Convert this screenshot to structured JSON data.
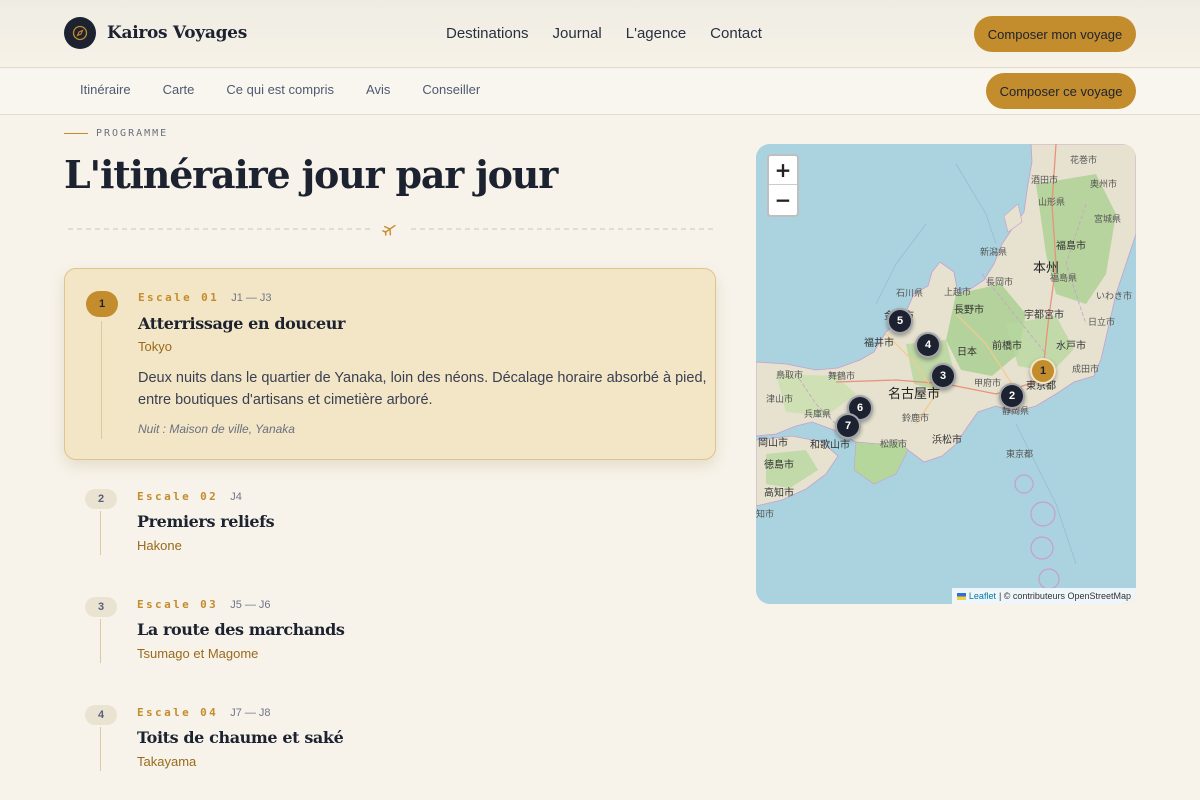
{
  "header": {
    "brand": "Kairos Voyages",
    "nav": [
      "Destinations",
      "Journal",
      "L'agence",
      "Contact"
    ],
    "cta": "Composer mon voyage"
  },
  "subnav": {
    "items": [
      "Itinéraire",
      "Carte",
      "Ce qui est compris",
      "Avis",
      "Conseiller"
    ],
    "cta": "Composer ce voyage"
  },
  "section": {
    "eyebrow": "PROGRAMME",
    "title": "L'itinéraire jour par jour"
  },
  "stops": [
    {
      "num": "1",
      "escale": "Escale 01",
      "days": "J1 — J3",
      "title": "Atterrissage en douceur",
      "place": "Tokyo",
      "description": "Deux nuits dans le quartier de Yanaka, loin des néons. Décalage horaire absorbé à pied, entre boutiques d'artisans et cimetière arboré.",
      "nuit": "Nuit : Maison de ville, Yanaka"
    },
    {
      "num": "2",
      "escale": "Escale 02",
      "days": "J4",
      "title": "Premiers reliefs",
      "place": "Hakone"
    },
    {
      "num": "3",
      "escale": "Escale 03",
      "days": "J5 — J6",
      "title": "La route des marchands",
      "place": "Tsumago et Magome"
    },
    {
      "num": "4",
      "escale": "Escale 04",
      "days": "J7 — J8",
      "title": "Toits de chaume et saké",
      "place": "Takayama"
    }
  ],
  "map": {
    "zoom_in": "+",
    "zoom_out": "−",
    "attribution_leaflet": "Leaflet",
    "attribution_rest": "| © contributeurs OpenStreetMap",
    "labels": [
      "花巻市",
      "奥州市",
      "酒田市",
      "山形県",
      "宮城県",
      "福島市",
      "本州",
      "福島県",
      "新潟県",
      "いわき市",
      "石川県",
      "上越市",
      "長岡市",
      "宇都宮市",
      "日立市",
      "金沢市",
      "長野市",
      "福井市",
      "日本",
      "前橋市",
      "水戸市",
      "鳥取市",
      "舞鶴市",
      "甲府市",
      "東京都",
      "成田市",
      "津山市",
      "名古屋市",
      "兵庫県",
      "静岡県",
      "鈴鹿市",
      "岡山市",
      "和歌山市",
      "松阪市",
      "浜松市",
      "徳島市",
      "東京都",
      "高知市",
      "知市"
    ],
    "markers": [
      "1",
      "2",
      "3",
      "4",
      "5",
      "6",
      "7"
    ]
  },
  "colors": {
    "accent": "#c38c2c",
    "ink": "#1c2230",
    "card": "#f3e6c6",
    "water": "#aad3df"
  }
}
